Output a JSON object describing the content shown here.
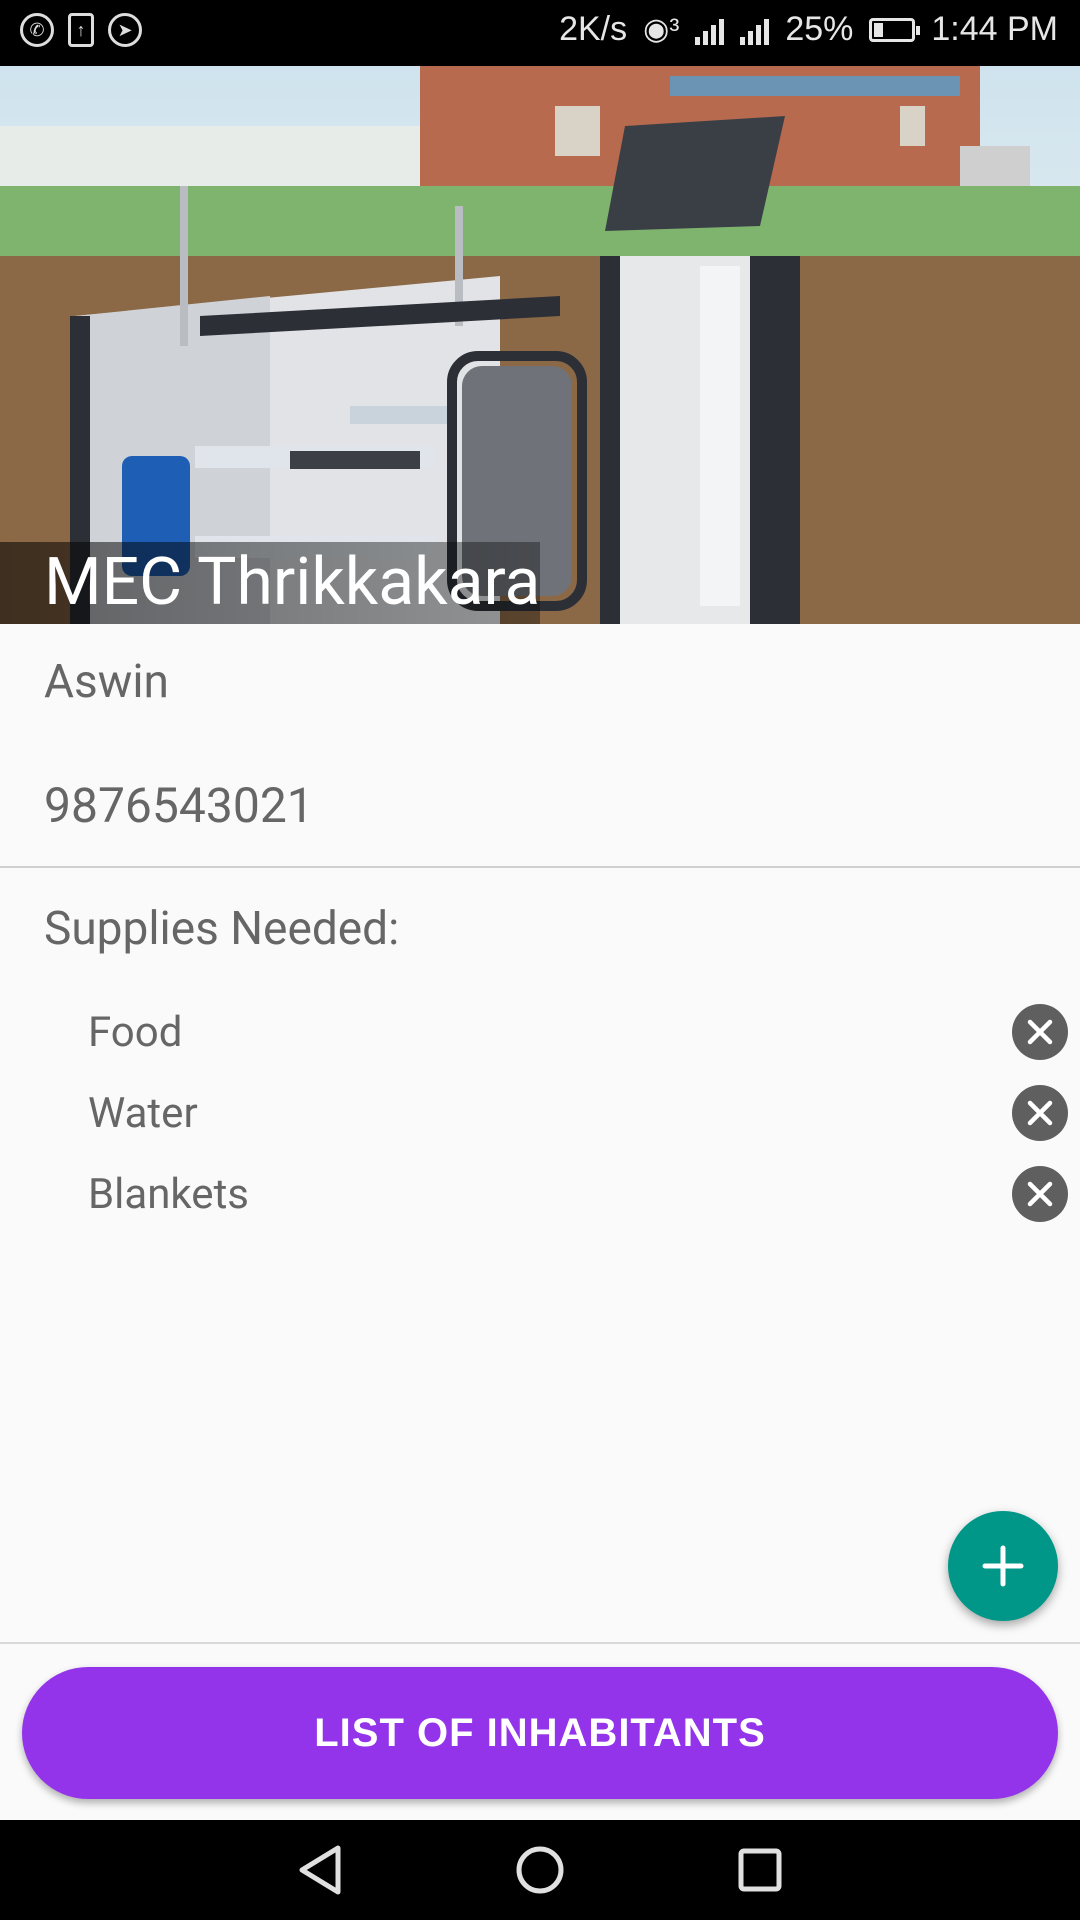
{
  "status_bar": {
    "speed": "2K/s",
    "battery": "25%",
    "battery_level": 0.25,
    "time": "1:44 PM",
    "left_icons": [
      "whatsapp-icon",
      "upload-icon",
      "telegram-icon"
    ]
  },
  "header": {
    "title": "MEC Thrikkakara"
  },
  "contact": {
    "name": "Aswin",
    "phone": "9876543021"
  },
  "supplies": {
    "title": "Supplies Needed:",
    "items": [
      {
        "label": "Food"
      },
      {
        "label": "Water"
      },
      {
        "label": "Blankets"
      }
    ]
  },
  "actions": {
    "list_button": "LIST OF INHABITANTS",
    "fab_icon": "plus-icon"
  },
  "colors": {
    "accent": "#9334ea",
    "fab": "#009688"
  }
}
